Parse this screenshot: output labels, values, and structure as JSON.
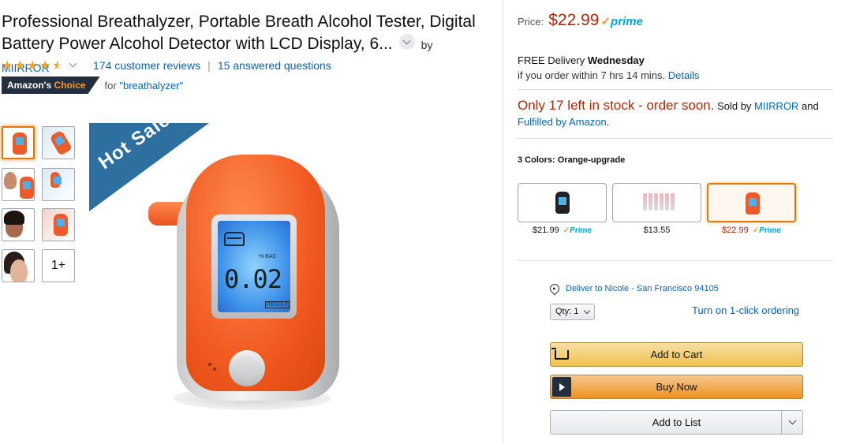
{
  "product": {
    "title": "Professional Breathalyzer, Portable Breath Alcohol Tester, Digital Battery Power Alcohol Detector with LCD Display, 6...",
    "by": "by",
    "brand": "MIIRROR",
    "rating": 4.5,
    "reviews": "174 customer reviews",
    "separator": "|",
    "answered": "15 answered questions",
    "choice_a": "Amazon's ",
    "choice_b": "Choice",
    "choice_for": "for ",
    "choice_query": "\"breathalyzer\"",
    "banner": "Hot Sale",
    "thumb_more": "1+",
    "screen_reading": "0.02",
    "screen_unit": "% BAC",
    "screen_result": "RESULT"
  },
  "buybox": {
    "price_label": "Price:",
    "price": "$22.99",
    "prime": "prime",
    "delivery_a": "FREE Delivery ",
    "delivery_day": "Wednesday",
    "delivery_b": "if you order within 7 hrs 14 mins. ",
    "details": "Details",
    "stock_red": "Only 17 left in stock - order soon.",
    "sold_by": " Sold by ",
    "seller": "MIIRROR",
    "and": " and",
    "fulfilled": "Fulfilled by Amazon",
    "period": ".",
    "colors_label": "3 Colors: Orange-upgrade",
    "swatches": [
      {
        "price": "$21.99",
        "prime": "Prime"
      },
      {
        "price": "$13.55",
        "prime": ""
      },
      {
        "price": "$22.99",
        "prime": "Prime"
      }
    ],
    "deliver_to": "Deliver to Nicole - San Francisco 94105",
    "qty_label": "Qty: 1",
    "oneclick": "Turn on 1-click ordering",
    "add_to_cart": "Add to Cart",
    "buy_now": "Buy Now",
    "add_to_list": "Add to List"
  },
  "colors": {
    "price_red": "#b12704",
    "link": "#0066c0",
    "prime_blue": "#00a8e1",
    "device_orange": "#f05a28"
  },
  "icons": [
    "chevron-down-icon",
    "star-icon",
    "location-pin-icon",
    "cart-icon",
    "play-icon"
  ]
}
